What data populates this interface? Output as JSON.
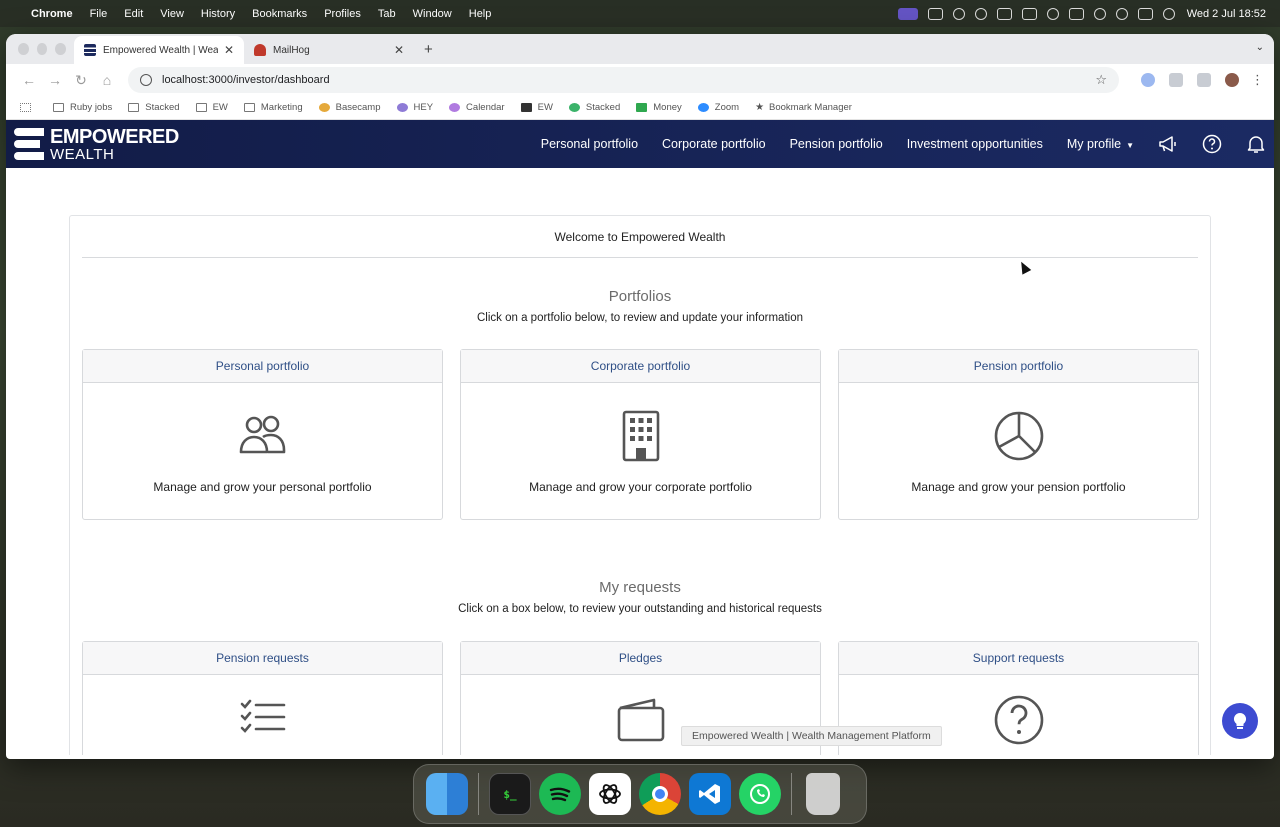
{
  "menubar": {
    "apple": "",
    "app_name": "Chrome",
    "menus": [
      "File",
      "Edit",
      "View",
      "History",
      "Bookmarks",
      "Profiles",
      "Tab",
      "Window",
      "Help"
    ],
    "clock": "Wed 2 Jul  18:52"
  },
  "browser": {
    "tabs": [
      {
        "title": "Empowered Wealth | Wealth M",
        "active": true
      },
      {
        "title": "MailHog",
        "active": false
      }
    ],
    "url": "localhost:3000/investor/dashboard",
    "bookmarks": [
      "Ruby jobs",
      "Stacked",
      "EW",
      "Marketing",
      "Basecamp",
      "HEY",
      "Calendar",
      "EW",
      "Stacked",
      "Money",
      "Zoom",
      "Bookmark Manager"
    ]
  },
  "app": {
    "logo_line1": "EMPOWERED",
    "logo_line2": "WEALTH",
    "nav": [
      "Personal portfolio",
      "Corporate portfolio",
      "Pension portfolio",
      "Investment opportunities",
      "My profile"
    ],
    "brand_color": "#16235a"
  },
  "dashboard": {
    "welcome": "Welcome to Empowered Wealth",
    "portfolios": {
      "title": "Portfolios",
      "subtitle": "Click on a portfolio below, to review and update your information",
      "tiles": [
        {
          "heading": "Personal portfolio",
          "icon": "people-icon",
          "text": "Manage and grow your personal portfolio"
        },
        {
          "heading": "Corporate portfolio",
          "icon": "building-icon",
          "text": "Manage and grow your corporate portfolio"
        },
        {
          "heading": "Pension portfolio",
          "icon": "pie-chart-icon",
          "text": "Manage and grow your pension portfolio"
        }
      ]
    },
    "requests": {
      "title": "My requests",
      "subtitle": "Click on a box below, to review your outstanding and historical requests",
      "tiles": [
        {
          "heading": "Pension requests",
          "icon": "checklist-icon"
        },
        {
          "heading": "Pledges",
          "icon": "wallet-icon"
        },
        {
          "heading": "Support requests",
          "icon": "question-icon"
        }
      ]
    },
    "tooltip": "Empowered Wealth | Wealth Management Platform"
  },
  "dock": {
    "apps": [
      "Finder",
      "Terminal",
      "Spotify",
      "ChatGPT",
      "Chrome",
      "VS Code",
      "WhatsApp",
      "Trash"
    ],
    "terminal_glyph": "$_"
  }
}
